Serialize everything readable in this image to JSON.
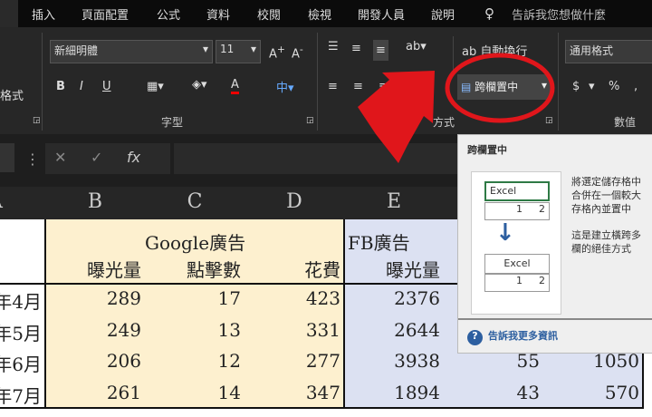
{
  "tabs": [
    "插入",
    "頁面配置",
    "公式",
    "資料",
    "校閱",
    "檢視",
    "開發人員",
    "說明"
  ],
  "tell_me": "告訴我您想做什麼",
  "ribbon": {
    "font_name": "新細明體",
    "font_size": "11",
    "wrap_text": "自動換行",
    "merge_center": "跨欄置中",
    "number_format": "通用格式",
    "group_font": "字型",
    "group_align": "方式",
    "group_number": "數值",
    "left_label": "格式",
    "bold": "B",
    "italic": "I",
    "underline": "U",
    "currency": "$",
    "percent": "%",
    "comma": ","
  },
  "formula_bar": {
    "cancel": "✕",
    "enter": "✓",
    "fx": "fx"
  },
  "columns": [
    "A",
    "B",
    "C",
    "D",
    "E"
  ],
  "sheet": {
    "google_header": "Google廣告",
    "fb_header": "FB廣告",
    "subheaders": [
      "曝光量",
      "點擊數",
      "花費",
      "曝光量"
    ],
    "rows": [
      {
        "label": "年4月",
        "b": "289",
        "c": "17",
        "d": "423",
        "e": "2376",
        "f": "",
        "g": ""
      },
      {
        "label": "年5月",
        "b": "249",
        "c": "13",
        "d": "331",
        "e": "2644",
        "f": "",
        "g": ""
      },
      {
        "label": "年6月",
        "b": "206",
        "c": "12",
        "d": "277",
        "e": "3938",
        "f": "55",
        "g": "1050"
      },
      {
        "label": "年7月",
        "b": "261",
        "c": "14",
        "d": "347",
        "e": "1894",
        "f": "43",
        "g": "570"
      }
    ]
  },
  "tooltip": {
    "title": "跨欄置中",
    "demo_text": "Excel",
    "demo_1": "1",
    "demo_2": "2",
    "desc1": "將選定儲存格中",
    "desc2": "合併在一個較大",
    "desc3": "存格內並置中",
    "desc4": "這是建立橫跨多",
    "desc5": "欄的絕佳方式",
    "link": "告訴我更多資訊"
  },
  "colors": {
    "google_fill": "#fdf0cf",
    "fb_fill": "#dce1f2",
    "annotation_red": "#e0161b"
  }
}
